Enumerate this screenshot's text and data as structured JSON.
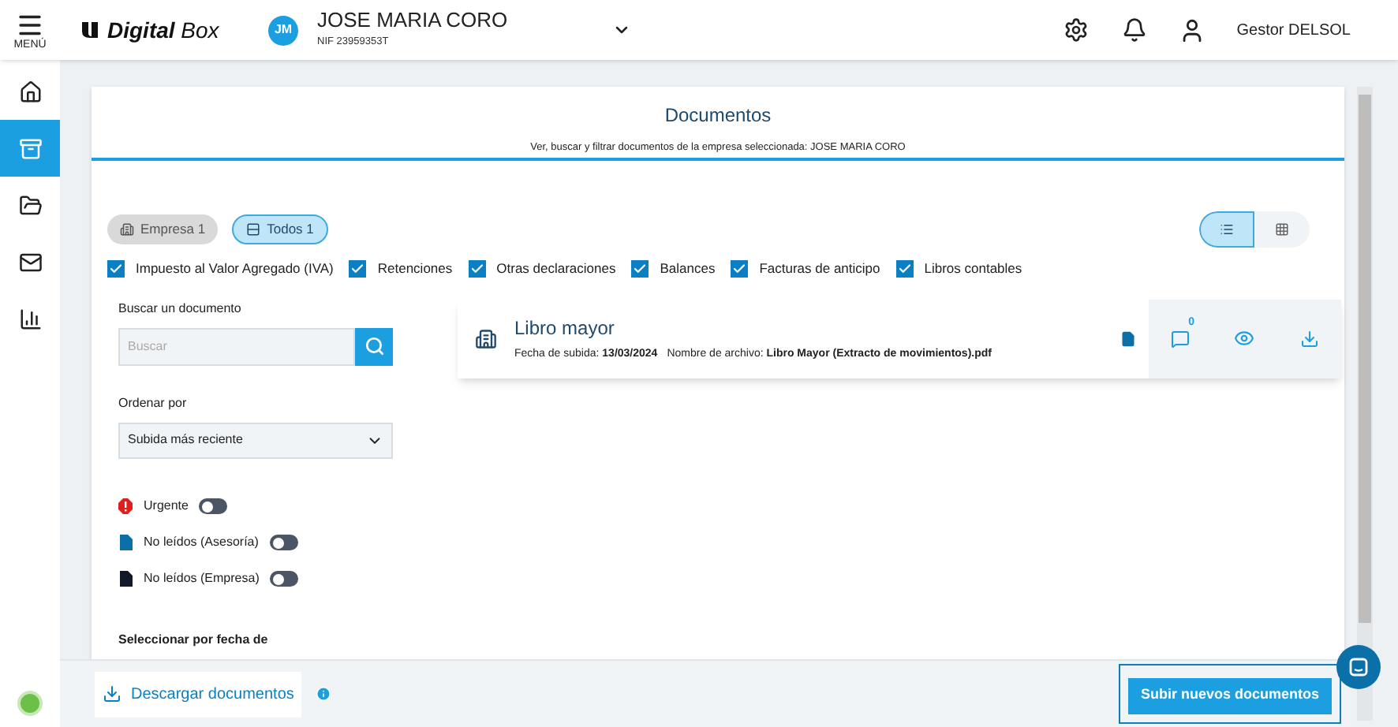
{
  "header": {
    "menu_label": "MENÚ",
    "brand": "**Digital** Box",
    "company": {
      "initials": "JM",
      "name": "JOSE MARIA CORO",
      "nif": "NIF 23959353T"
    },
    "user": "Gestor DELSOL"
  },
  "sidebar": {
    "items": [
      {
        "kind": "home",
        "selected": false
      },
      {
        "kind": "archive",
        "selected": true
      },
      {
        "kind": "folder",
        "selected": false
      },
      {
        "kind": "mail",
        "selected": false
      },
      {
        "kind": "chart",
        "selected": false
      }
    ]
  },
  "page": {
    "title": "Documentos",
    "subtitle": "Ver, buscar y filtrar documentos de la empresa seleccionada: JOSE MARIA CORO"
  },
  "chips": [
    {
      "kind": "company",
      "label": "Empresa 1",
      "selected": false
    },
    {
      "kind": "all",
      "label": "Todos 1",
      "selected": true
    }
  ],
  "view_toggle": [
    {
      "kind": "list",
      "selected": true
    },
    {
      "kind": "grid",
      "selected": false
    }
  ],
  "categories": [
    {
      "label": "Impuesto al Valor Agregado (IVA)",
      "checked": true
    },
    {
      "label": "Retenciones",
      "checked": true
    },
    {
      "label": "Otras declaraciones",
      "checked": true
    },
    {
      "label": "Balances",
      "checked": true
    },
    {
      "label": "Facturas de anticipo",
      "checked": true
    },
    {
      "label": "Libros contables",
      "checked": true
    }
  ],
  "search": {
    "label": "Buscar un documento",
    "placeholder": "Buscar"
  },
  "sort": {
    "label": "Ordenar por",
    "value": "Subida más reciente"
  },
  "toggles": [
    {
      "kind": "urgent",
      "label": "Urgente",
      "on": false
    },
    {
      "kind": "advisor",
      "label": "No leídos (Asesoría)",
      "on": false
    },
    {
      "kind": "company",
      "label": "No leídos (Empresa)",
      "on": false
    }
  ],
  "date_filter_label": "Seleccionar por fecha de",
  "documents": [
    {
      "title": "Libro mayor",
      "date": "Fecha de subida: **13/03/2024**",
      "file": "Nombre de archivo: **Libro Mayor (Extracto de movimientos).pdf**",
      "comments": "0"
    }
  ],
  "footer": {
    "download_button": "Descargar documentos",
    "upload_button": "Subir nuevos documentos"
  }
}
